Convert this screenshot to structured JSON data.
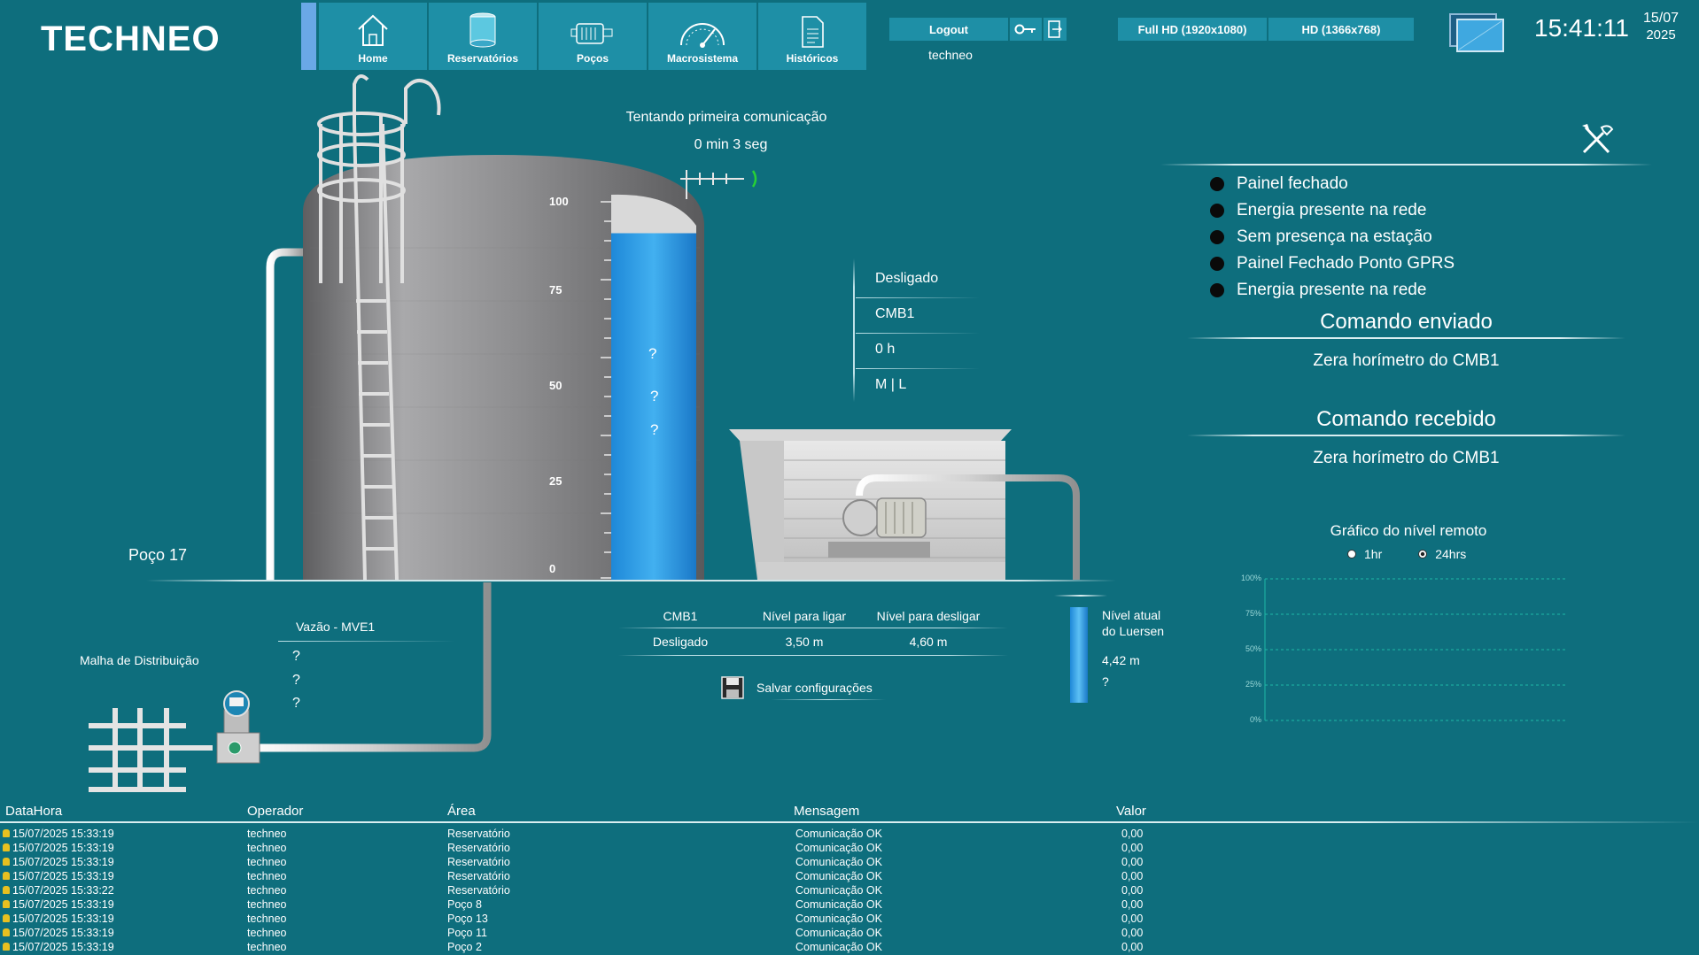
{
  "header": {
    "logo": "TECHNEO",
    "nav": [
      {
        "label": "Home",
        "icon": "home-icon"
      },
      {
        "label": "Reservatórios",
        "icon": "reservoir-icon"
      },
      {
        "label": "Poços",
        "icon": "well-pump-icon"
      },
      {
        "label": "Macrosistema",
        "icon": "gauge-icon"
      },
      {
        "label": "Históricos",
        "icon": "document-icon"
      }
    ],
    "logout_label": "Logout",
    "username": "techneo",
    "res_full_hd": "Full HD (1920x1080)",
    "res_hd": "HD (1366x768)",
    "time": "15:41:11",
    "date_day": "15/07",
    "date_year": "2025"
  },
  "comm": {
    "status": "Tentando primeira comunicação",
    "elapsed": "0 min 3 seg"
  },
  "tank": {
    "scale": [
      "100",
      "75",
      "50",
      "25",
      "0"
    ],
    "levels": [
      "?",
      "?",
      "?"
    ],
    "fill_fraction": 0.9
  },
  "station_name": "Poço 17",
  "pump_info": [
    "Desligado",
    "CMB1",
    "0 h",
    "M | L"
  ],
  "status_list": [
    "Painel fechado",
    "Energia presente na rede",
    "Sem presença na estação",
    "Painel Fechado Ponto GPRS",
    "Energia presente na rede"
  ],
  "command_sent": {
    "title": "Comando enviado",
    "value": "Zera horímetro do CMB1"
  },
  "command_received": {
    "title": "Comando recebido",
    "value": "Zera horímetro do CMB1"
  },
  "flow": {
    "title": "Vazão - MVE1",
    "values": [
      "?",
      "?",
      "?"
    ]
  },
  "distribution_label": "Malha de Distribuição",
  "config_table": {
    "headers": [
      "CMB1",
      "Nível para ligar",
      "Nível para desligar"
    ],
    "values": [
      "Desligado",
      "3,50 m",
      "4,60 m"
    ]
  },
  "save_label": "Salvar configurações",
  "remote_level": {
    "title_line1": "Nível atual",
    "title_line2": "do Luersen",
    "value": "4,42 m",
    "status": "?"
  },
  "graph": {
    "title": "Gráfico do nível remoto",
    "option_1h": "1hr",
    "option_24h": "24hrs",
    "selected": "24hrs",
    "y_ticks": [
      "100%",
      "75%",
      "50%",
      "25%",
      "0%"
    ]
  },
  "log": {
    "columns": [
      "DataHora",
      "Operador",
      "Área",
      "Mensagem",
      "Valor"
    ],
    "rows": [
      [
        "15/07/2025 15:33:19",
        "techneo",
        "Reservatório",
        "Comunicação OK",
        "0,00"
      ],
      [
        "15/07/2025 15:33:19",
        "techneo",
        "Reservatório",
        "Comunicação OK",
        "0,00"
      ],
      [
        "15/07/2025 15:33:19",
        "techneo",
        "Reservatório",
        "Comunicação OK",
        "0,00"
      ],
      [
        "15/07/2025 15:33:19",
        "techneo",
        "Reservatório",
        "Comunicação OK",
        "0,00"
      ],
      [
        "15/07/2025 15:33:22",
        "techneo",
        "Reservatório",
        "Comunicação OK",
        "0,00"
      ],
      [
        "15/07/2025 15:33:19",
        "techneo",
        "Poço 8",
        "Comunicação OK",
        "0,00"
      ],
      [
        "15/07/2025 15:33:19",
        "techneo",
        "Poço 13",
        "Comunicação OK",
        "0,00"
      ],
      [
        "15/07/2025 15:33:19",
        "techneo",
        "Poço 11",
        "Comunicação OK",
        "0,00"
      ],
      [
        "15/07/2025 15:33:19",
        "techneo",
        "Poço 2",
        "Comunicação OK",
        "0,00"
      ]
    ]
  }
}
